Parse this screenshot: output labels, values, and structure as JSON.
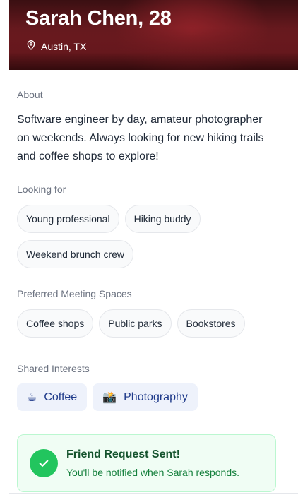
{
  "profile": {
    "name_age": "Sarah Chen, 28",
    "location": "Austin, TX",
    "location_icon": "map-pin-icon"
  },
  "about": {
    "label": "About",
    "text": "Software engineer by day, amateur photographer on weekends. Always looking for new hiking trails and coffee shops to explore!"
  },
  "looking_for": {
    "label": "Looking for",
    "items": [
      "Young professional",
      "Hiking buddy",
      "Weekend brunch crew"
    ]
  },
  "meeting_spaces": {
    "label": "Preferred Meeting Spaces",
    "items": [
      "Coffee shops",
      "Public parks",
      "Bookstores"
    ]
  },
  "shared_interests": {
    "label": "Shared Interests",
    "items": [
      {
        "emoji": "☕",
        "label": "Coffee"
      },
      {
        "emoji": "📸",
        "label": "Photography"
      }
    ]
  },
  "notice": {
    "title": "Friend Request Sent!",
    "subtitle": "You'll be notified when Sarah responds.",
    "icon": "check-icon"
  },
  "colors": {
    "accent_green": "#22c55e",
    "interest_text": "#1e3a8a",
    "interest_bg": "#eef2fb"
  }
}
